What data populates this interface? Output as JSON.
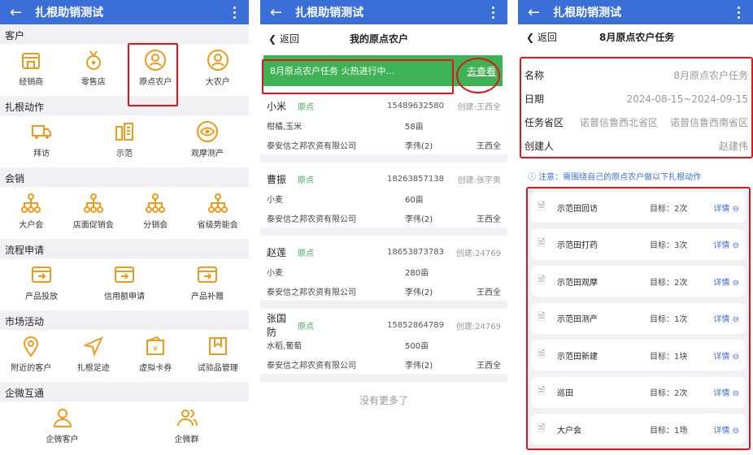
{
  "app_title": "扎根助销测试",
  "panel1": {
    "sections": [
      {
        "title": "客户",
        "items": [
          {
            "label": "经销商",
            "icon": "store-icon"
          },
          {
            "label": "零售店",
            "icon": "medal-icon"
          },
          {
            "label": "原点农户",
            "icon": "person-circle-icon"
          },
          {
            "label": "大农户",
            "icon": "person-circle-icon"
          }
        ]
      },
      {
        "title": "扎根动作",
        "items": [
          {
            "label": "拜访",
            "icon": "truck-icon"
          },
          {
            "label": "示范",
            "icon": "demo-icon"
          },
          {
            "label": "观摩测产",
            "icon": "eye-icon"
          }
        ]
      },
      {
        "title": "会销",
        "items": [
          {
            "label": "大户会",
            "icon": "org-chart-icon"
          },
          {
            "label": "店面促销会",
            "icon": "org-chart-icon"
          },
          {
            "label": "分销会",
            "icon": "org-chart-icon"
          },
          {
            "label": "省级势能会",
            "icon": "org-chart-icon"
          }
        ]
      },
      {
        "title": "流程申请",
        "items": [
          {
            "label": "产品投放",
            "icon": "transfer-icon"
          },
          {
            "label": "信用额申请",
            "icon": "transfer-icon"
          },
          {
            "label": "产品补赠",
            "icon": "transfer-icon"
          }
        ]
      },
      {
        "title": "市场活动",
        "items": [
          {
            "label": "附近的客户",
            "icon": "location-pin-icon"
          },
          {
            "label": "扎根足迹",
            "icon": "navigation-icon"
          },
          {
            "label": "虚拟卡券",
            "icon": "coupon-icon"
          },
          {
            "label": "试验品管理",
            "icon": "bookmark-icon"
          }
        ]
      },
      {
        "title": "企微互通",
        "items": [
          {
            "label": "企微客户",
            "icon": "person-icon"
          },
          {
            "label": "企微群",
            "icon": "group-icon"
          }
        ]
      }
    ]
  },
  "panel2": {
    "back": "返回",
    "title": "我的原点农户",
    "banner_text": "8月原点农户任务 火热进行中...",
    "banner_link": "去查看",
    "farmers": [
      {
        "name": "小米",
        "tag": "原点",
        "phone": "15489632580",
        "creator": "创建:王西全",
        "crops": "柑橘,玉米",
        "area": "58亩",
        "company": "泰安信之邦农资有限公司",
        "agent": "李伟(2)",
        "owner": "王西全"
      },
      {
        "name": "曹振",
        "tag": "原点",
        "phone": "18263857138",
        "creator": "创建:张宇奥",
        "crops": "小麦",
        "area": "60亩",
        "company": "泰安信之邦农资有限公司",
        "agent": "李伟(2)",
        "owner": "王西全"
      },
      {
        "name": "赵莲",
        "tag": "原点",
        "phone": "18653873783",
        "creator": "创建:24769",
        "crops": "小麦",
        "area": "280亩",
        "company": "泰安信之邦农资有限公司",
        "agent": "李伟(2)",
        "owner": "王西全"
      },
      {
        "name": "张国防",
        "tag": "原点",
        "phone": "15852864789",
        "creator": "创建:24769",
        "crops": "水稻,葡萄",
        "area": "500亩",
        "company": "泰安信之邦农资有限公司",
        "agent": "李伟(2)",
        "owner": "王西全"
      }
    ],
    "no_more": "没有更多了"
  },
  "panel3": {
    "back": "返回",
    "title": "8月原点农户任务",
    "info": {
      "name_label": "名称",
      "name_value": "8月原点农户任务",
      "date_label": "日期",
      "date_value": "2024-08-15~2024-09-15",
      "region_label": "任务省区",
      "region_value1": "诺普信鲁西北省区",
      "region_value2": "诺普信鲁西南省区",
      "creator_label": "创建人",
      "creator_value": "赵建伟"
    },
    "note": "注意：需围绕自己的原点农户做以下扎根动作",
    "tasks": [
      {
        "name": "示范田回访",
        "target": "目标：2次",
        "detail": "详情"
      },
      {
        "name": "示范田打药",
        "target": "目标：3次",
        "detail": "详情"
      },
      {
        "name": "示范田观摩",
        "target": "目标：2次",
        "detail": "详情"
      },
      {
        "name": "示范田测产",
        "target": "目标：1次",
        "detail": "详情"
      },
      {
        "name": "示范田新建",
        "target": "目标：1块",
        "detail": "详情"
      },
      {
        "name": "巡田",
        "target": "目标：2次",
        "detail": "详情"
      },
      {
        "name": "大户会",
        "target": "目标：1场",
        "detail": "详情"
      }
    ]
  },
  "colors": {
    "primary": "#3a6fd8",
    "accent_orange": "#f19a1a",
    "green": "#3fb255",
    "highlight_red": "#e1141c"
  }
}
